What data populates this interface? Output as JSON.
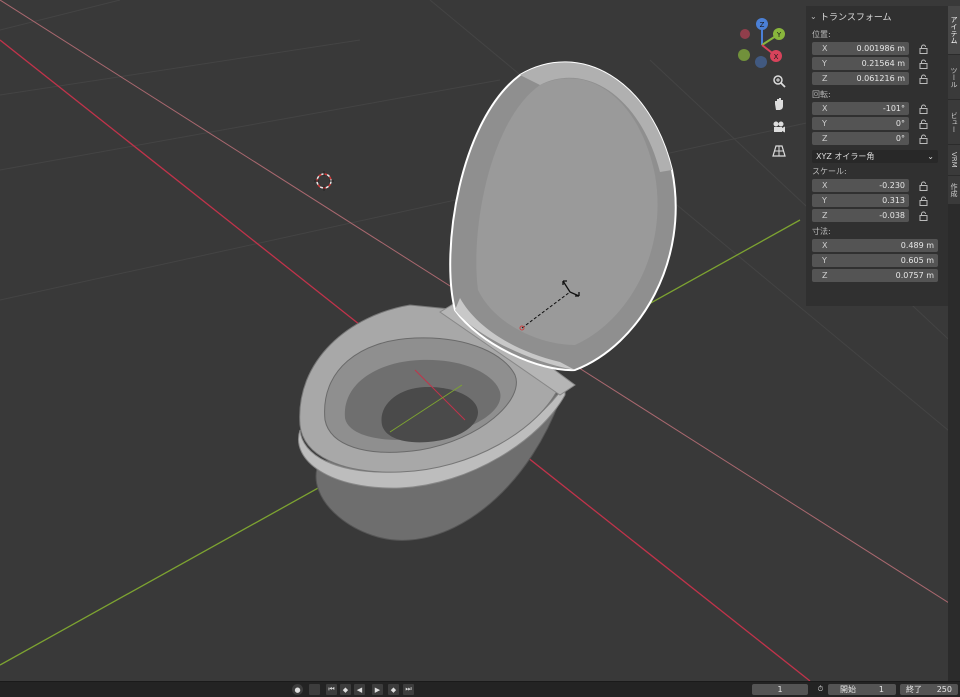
{
  "transform_panel": {
    "title": "トランスフォーム",
    "location": {
      "label": "位置:",
      "x": {
        "axis": "X",
        "value": "0.001986 m"
      },
      "y": {
        "axis": "Y",
        "value": "0.21564 m"
      },
      "z": {
        "axis": "Z",
        "value": "0.061216 m"
      }
    },
    "rotation": {
      "label": "回転:",
      "x": {
        "axis": "X",
        "value": "-101°"
      },
      "y": {
        "axis": "Y",
        "value": "0°"
      },
      "z": {
        "axis": "Z",
        "value": "0°"
      },
      "mode": "XYZ オイラー角"
    },
    "scale": {
      "label": "スケール:",
      "x": {
        "axis": "X",
        "value": "-0.230"
      },
      "y": {
        "axis": "Y",
        "value": "0.313"
      },
      "z": {
        "axis": "Z",
        "value": "-0.038"
      }
    },
    "dimensions": {
      "label": "寸法:",
      "x": {
        "axis": "X",
        "value": "0.489 m"
      },
      "y": {
        "axis": "Y",
        "value": "0.605 m"
      },
      "z": {
        "axis": "Z",
        "value": "0.0757 m"
      }
    }
  },
  "side_tabs": [
    "アイテム",
    "ツール",
    "ビュー",
    "VRM",
    "作成"
  ],
  "gizmo": {
    "x": "X",
    "y": "Y",
    "z": "Z"
  },
  "timeline": {
    "current_frame": "1",
    "start_label": "開始",
    "start_value": "1",
    "end_label": "終了",
    "end_value": "250"
  },
  "colors": {
    "x_axis": "#c0334a",
    "y_axis": "#7da331",
    "z_axis": "#3a74c7",
    "background": "#393939",
    "panel": "#303030",
    "field": "#545454"
  }
}
